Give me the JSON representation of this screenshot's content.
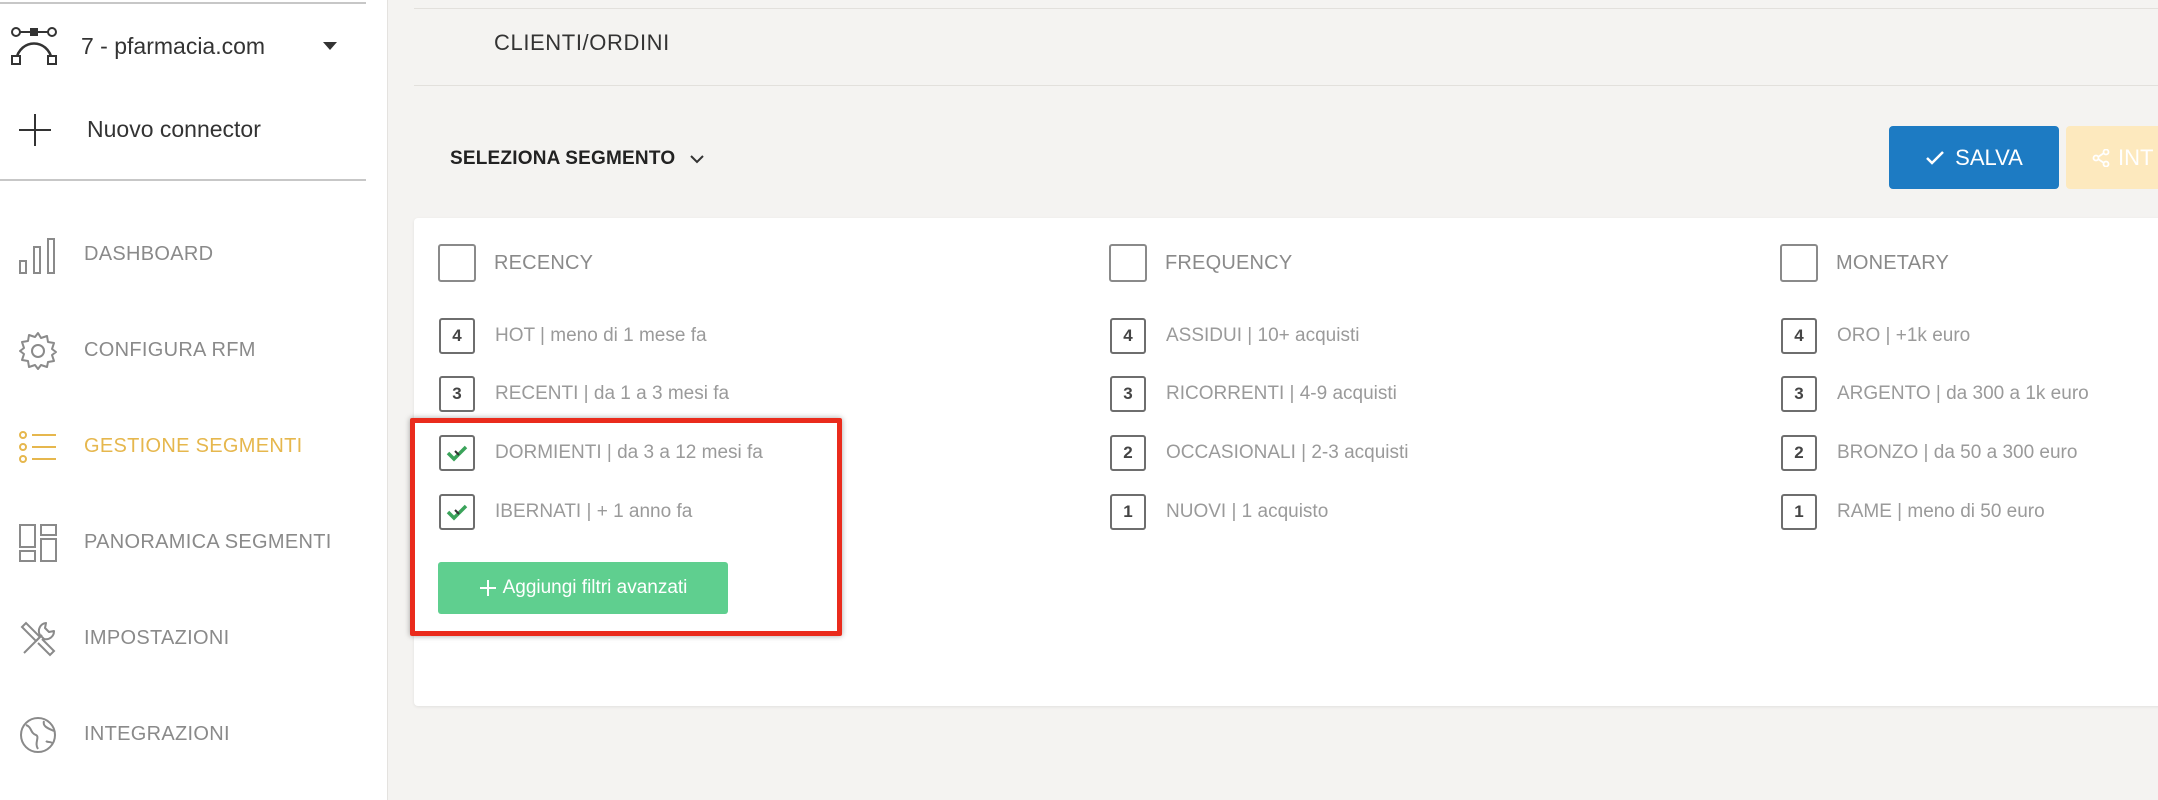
{
  "sidebar": {
    "account_label": "7 - pfarmacia.com",
    "new_connector_label": "Nuovo connector",
    "nav": [
      {
        "label": "DASHBOARD",
        "icon": "bar-chart-icon",
        "active": false
      },
      {
        "label": "CONFIGURA RFM",
        "icon": "gear-icon",
        "active": false
      },
      {
        "label": "GESTIONE SEGMENTI",
        "icon": "list-icon",
        "active": true
      },
      {
        "label": "PANORAMICA SEGMENTI",
        "icon": "layout-grid-icon",
        "active": false
      },
      {
        "label": "IMPOSTAZIONI",
        "icon": "tools-icon",
        "active": false
      },
      {
        "label": "INTEGRAZIONI",
        "icon": "globe-icon",
        "active": false
      }
    ]
  },
  "main": {
    "page_title": "CLIENTI/ORDINI",
    "segment_select_label": "SELEZIONA SEGMENTO",
    "save_label": "SALVA",
    "int_label": "INT",
    "add_filters_label": "Aggiungi filtri avanzati",
    "columns": [
      {
        "title": "RECENCY",
        "options": [
          {
            "num": "4",
            "label": "HOT | meno di 1 mese fa",
            "checked": false
          },
          {
            "num": "3",
            "label": "RECENTI | da 1 a 3 mesi fa",
            "checked": false
          },
          {
            "num": "",
            "label": "DORMIENTI | da 3 a 12 mesi fa",
            "checked": true
          },
          {
            "num": "",
            "label": "IBERNATI | + 1 anno fa",
            "checked": true
          }
        ]
      },
      {
        "title": "FREQUENCY",
        "options": [
          {
            "num": "4",
            "label": "ASSIDUI | 10+ acquisti",
            "checked": false
          },
          {
            "num": "3",
            "label": "RICORRENTI | 4-9 acquisti",
            "checked": false
          },
          {
            "num": "2",
            "label": "OCCASIONALI | 2-3 acquisti",
            "checked": false
          },
          {
            "num": "1",
            "label": "NUOVI | 1 acquisto",
            "checked": false
          }
        ]
      },
      {
        "title": "MONETARY",
        "options": [
          {
            "num": "4",
            "label": "ORO | +1k euro",
            "checked": false
          },
          {
            "num": "3",
            "label": "ARGENTO | da 300 a 1k euro",
            "checked": false
          },
          {
            "num": "2",
            "label": "BRONZO | da 50 a 300 euro",
            "checked": false
          },
          {
            "num": "1",
            "label": "RAME | meno di 50 euro",
            "checked": false
          }
        ]
      }
    ]
  },
  "colors": {
    "accent_active": "#e6b74d",
    "save_button": "#1d7bc3",
    "add_button": "#5fcf8f",
    "highlight": "#ea2b1c",
    "check": "#3aa35a"
  }
}
